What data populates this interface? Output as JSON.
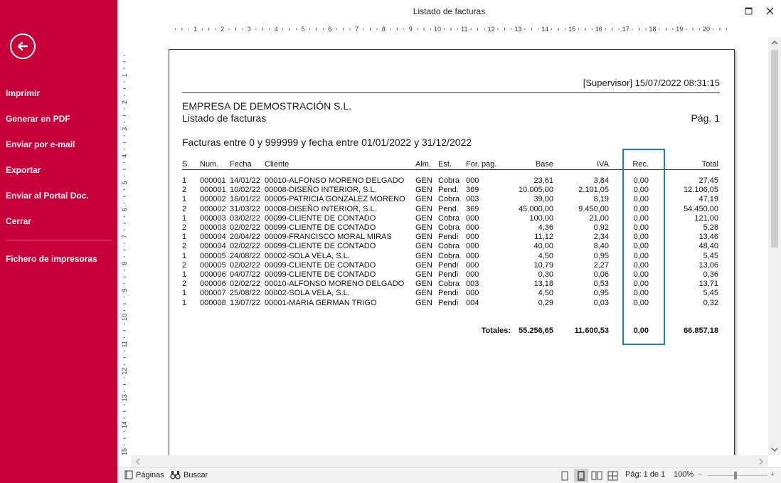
{
  "window": {
    "title": "Listado de facturas"
  },
  "sidebar": {
    "items": [
      {
        "label": "Imprimir"
      },
      {
        "label": "Generar en PDF"
      },
      {
        "label": "Enviar por e-mail"
      },
      {
        "label": "Exportar"
      },
      {
        "label": "Enviar al Portal Doc."
      },
      {
        "label": "Cerrar"
      }
    ],
    "secondary": [
      {
        "label": "Fichero de impresoras"
      }
    ]
  },
  "ruler": {
    "horizontal": [
      "1",
      "2",
      "3",
      "4",
      "5",
      "6",
      "7",
      "8",
      "9",
      "10",
      "11",
      "12",
      "13",
      "14",
      "15",
      "16",
      "17",
      "18",
      "19",
      "20"
    ],
    "vertical": [
      "1",
      "2",
      "3",
      "4",
      "5",
      "6",
      "7",
      "8",
      "9",
      "10",
      "11",
      "12",
      "13",
      "14",
      "15"
    ]
  },
  "report": {
    "supervisor": "[Supervisor] 15/07/2022 08:31:15",
    "company": "EMPRESA DE DEMOSTRACIÓN S.L.",
    "subtitle": "Listado de facturas",
    "page": "Pág. 1",
    "filter": "Facturas entre 0 y 999999 y fecha entre 01/01/2022 y 31/12/2022",
    "columns": [
      "S.",
      "Num.",
      "Fecha",
      "Cliente",
      "Alm.",
      "Est.",
      "For. pag.",
      "Base",
      "IVA",
      "Rec.",
      "Total"
    ],
    "rows": [
      [
        "1",
        "000001",
        "14/01/22",
        "00010-ALFONSO MORENO DELGADO",
        "GEN",
        "Cobra",
        "000",
        "23,61",
        "3,84",
        "0,00",
        "27,45"
      ],
      [
        "2",
        "000001",
        "10/02/22",
        "00008-DISEÑO INTERIOR, S.L.",
        "GEN",
        "Pend.",
        "369",
        "10.005,00",
        "2.101,05",
        "0,00",
        "12.106,05"
      ],
      [
        "1",
        "000002",
        "16/01/22",
        "00005-PATRICIA GONZALEZ MORENO",
        "GEN",
        "Cobra",
        "003",
        "39,00",
        "8,19",
        "0,00",
        "47,19"
      ],
      [
        "2",
        "000002",
        "31/03/22",
        "00008-DISEÑO INTERIOR, S.L.",
        "GEN",
        "Pend.",
        "369",
        "45.000,00",
        "9.450,00",
        "0,00",
        "54.450,00"
      ],
      [
        "1",
        "000003",
        "03/02/22",
        "00099-CLIENTE DE CONTADO",
        "GEN",
        "Cobra",
        "000",
        "100,00",
        "21,00",
        "0,00",
        "121,00"
      ],
      [
        "2",
        "000003",
        "02/02/22",
        "00099-CLIENTE DE CONTADO",
        "GEN",
        "Cobra",
        "000",
        "4,36",
        "0,92",
        "0,00",
        "5,28"
      ],
      [
        "1",
        "000004",
        "20/04/22",
        "00009-FRANCISCO MORAL MIRAS",
        "GEN",
        "Pendi",
        "000",
        "11,12",
        "2,34",
        "0,00",
        "13,46"
      ],
      [
        "2",
        "000004",
        "02/02/22",
        "00099-CLIENTE DE CONTADO",
        "GEN",
        "Cobra",
        "000",
        "40,00",
        "8,40",
        "0,00",
        "48,40"
      ],
      [
        "1",
        "000005",
        "24/08/22",
        "00002-SOLA VELA, S.L.",
        "GEN",
        "Cobra",
        "000",
        "4,50",
        "0,95",
        "0,00",
        "5,45"
      ],
      [
        "2",
        "000005",
        "02/02/22",
        "00099-CLIENTE DE CONTADO",
        "GEN",
        "Pendi",
        "000",
        "10,79",
        "2,27",
        "0,00",
        "13,06"
      ],
      [
        "1",
        "000006",
        "04/07/22",
        "00099-CLIENTE DE CONTADO",
        "GEN",
        "Pendi",
        "000",
        "0,30",
        "0,06",
        "0,00",
        "0,36"
      ],
      [
        "2",
        "000006",
        "02/02/22",
        "00010-ALFONSO MORENO DELGADO",
        "GEN",
        "Cobra",
        "003",
        "13,18",
        "0,53",
        "0,00",
        "13,71"
      ],
      [
        "1",
        "000007",
        "25/08/22",
        "00002-SOLA VELA, S.L.",
        "GEN",
        "Pendi",
        "000",
        "4,50",
        "0,95",
        "0,00",
        "5,45"
      ],
      [
        "1",
        "000008",
        "13/07/22",
        "00001-MARIA GERMAN TRIGO",
        "GEN",
        "Pendi",
        "004",
        "0,29",
        "0,03",
        "0,00",
        "0,32"
      ]
    ],
    "totals": {
      "label": "Totales:",
      "base": "55.256,65",
      "iva": "11.600,53",
      "rec": "0,00",
      "total": "66.857,18"
    }
  },
  "statusbar": {
    "pages_label": "Páginas",
    "search_label": "Buscar",
    "page_info": "Pág: 1 de 1",
    "zoom": "100%",
    "zoom_minus": "−",
    "zoom_plus": "+"
  },
  "colors": {
    "sidebar": "#c8003a",
    "highlight": "#1f7ec8"
  }
}
